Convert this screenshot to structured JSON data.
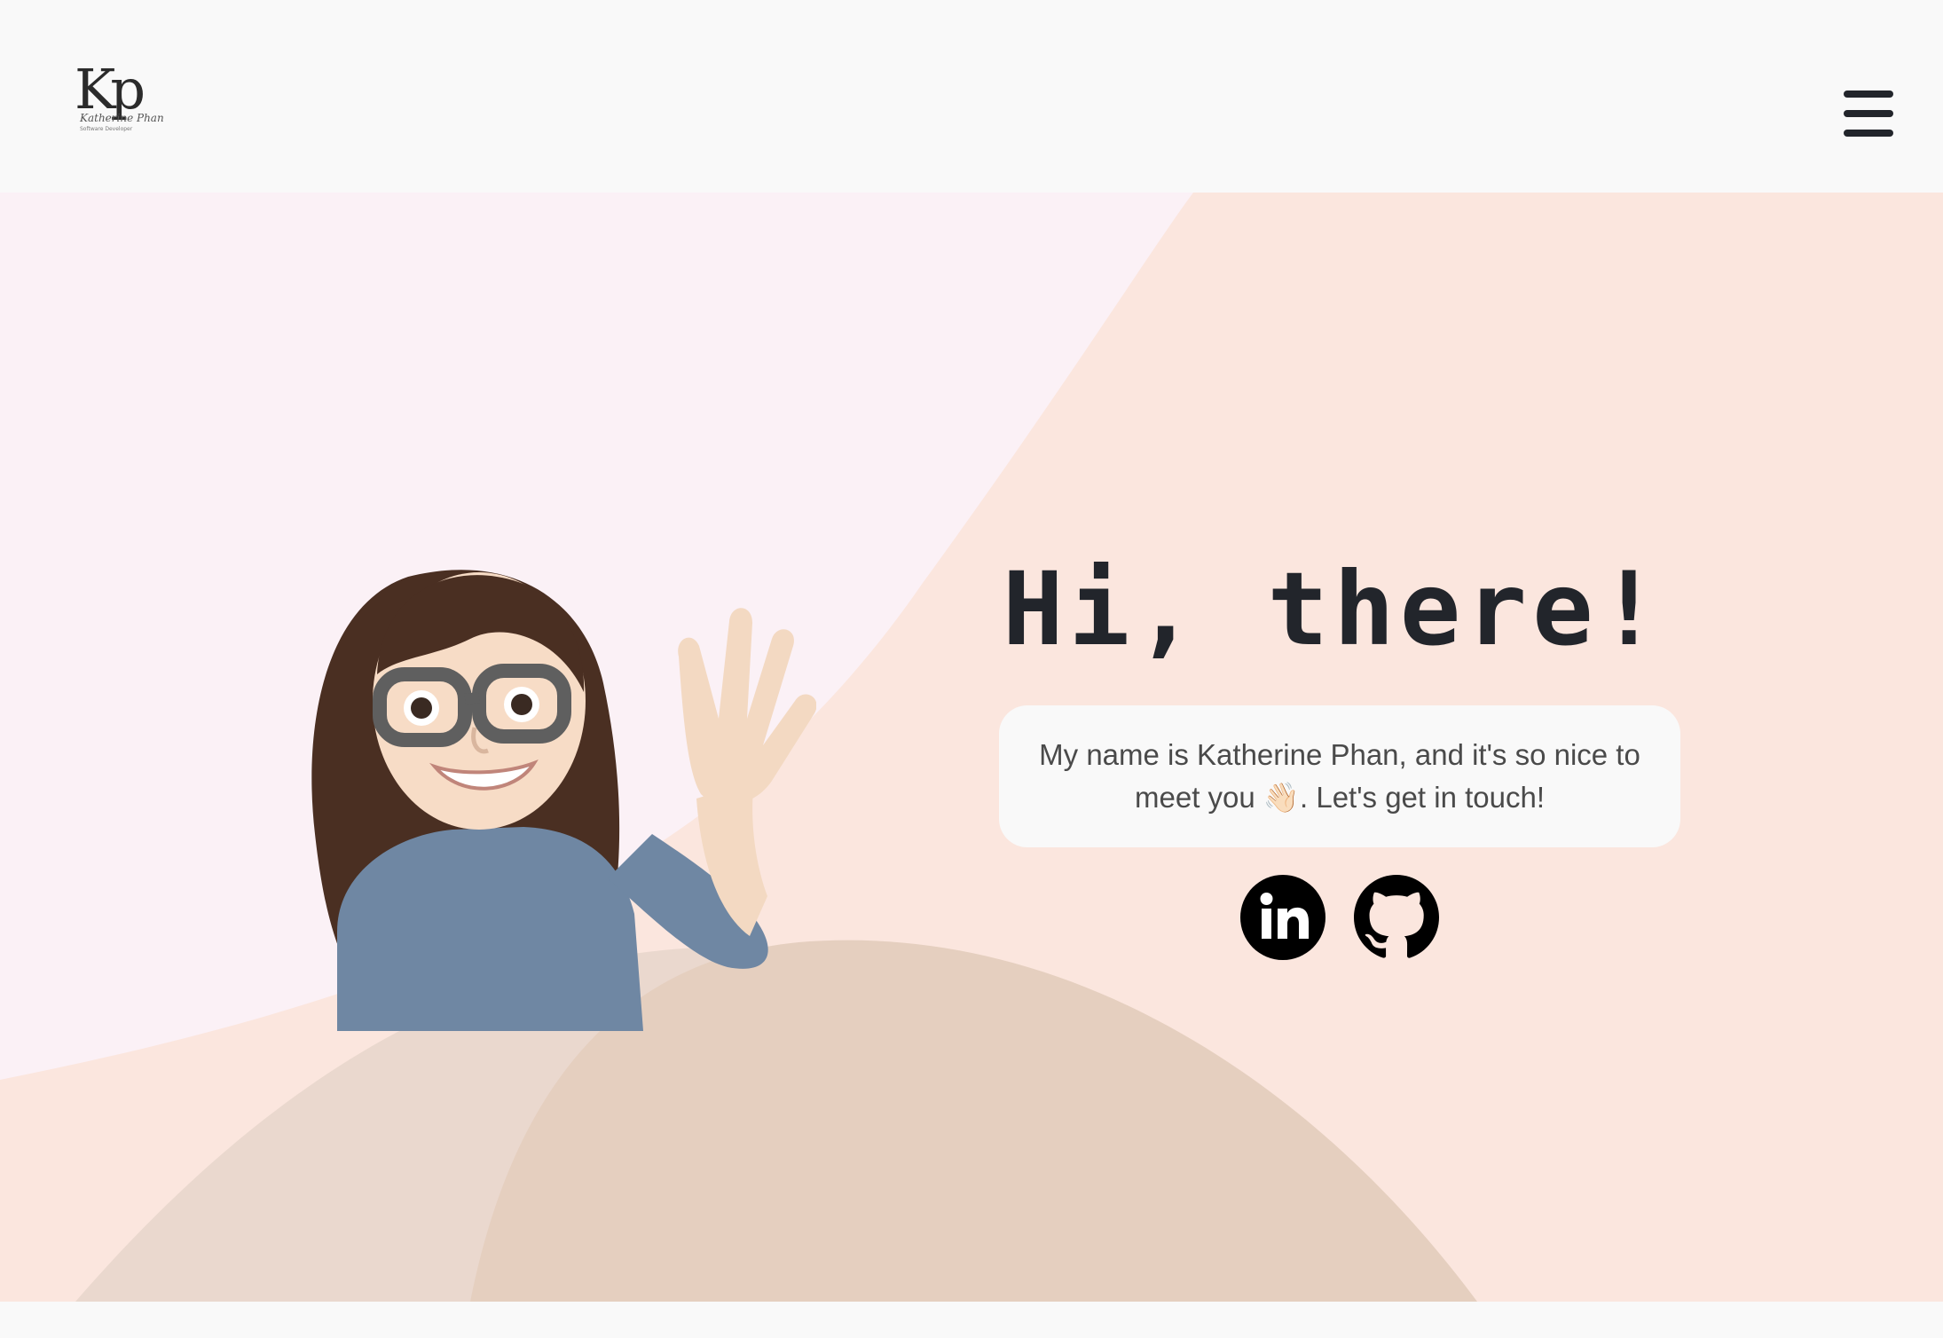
{
  "header": {
    "logo_monogram": "Kp",
    "logo_signature": "Katherine Phan",
    "logo_tagline": "Software Developer",
    "menu_icon": "hamburger-menu-icon"
  },
  "hero": {
    "greeting": "Hi, there!",
    "intro_text": "My name is Katherine Phan, and it's so nice to meet you 👋🏻. Let's get in touch!",
    "avatar": "waving-memoji-avatar"
  },
  "social_links": [
    {
      "name": "LinkedIn",
      "icon": "linkedin-icon"
    },
    {
      "name": "GitHub",
      "icon": "github-icon"
    }
  ],
  "colors": {
    "header_bg": "#f9f9f9",
    "hero_pink": "#fbf1f6",
    "hero_peach": "#fbe6de",
    "hill_light": "#ead8ce",
    "hill_tan": "#e5cfbf",
    "text_dark": "#22252b",
    "card_bg": "#f9f9f9"
  }
}
